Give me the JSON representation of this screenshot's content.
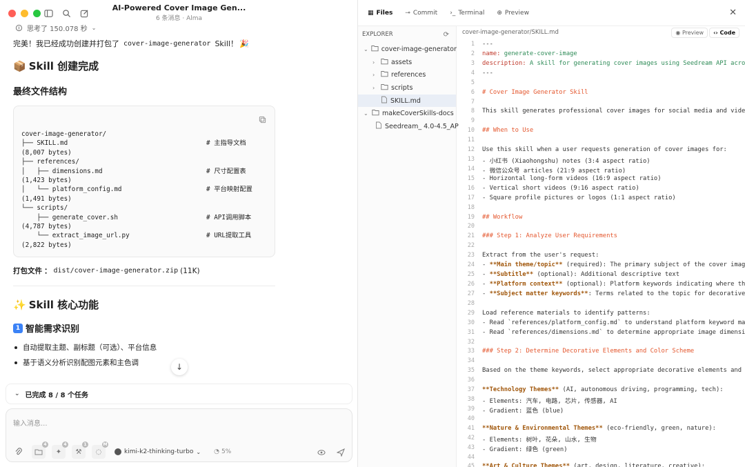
{
  "window": {
    "title": "AI-Powered Cover Image Gen...",
    "subtitle": "6 条消息 · Alma"
  },
  "chat": {
    "thought": "思考了 150.078 秒",
    "intro_prefix": "完美！我已经成功创建并打包了",
    "intro_code": "cover-image-generator",
    "intro_suffix": "Skill！",
    "h2_done": "Skill 创建完成",
    "h3_structure": "最终文件结构",
    "tree": [
      {
        "t": "cover-image-generator/",
        "c": ""
      },
      {
        "t": "├── SKILL.md",
        "c": "# 主指导文档"
      },
      {
        "t": "(8,007 bytes)",
        "c": ""
      },
      {
        "t": "├── references/",
        "c": ""
      },
      {
        "t": "│   ├── dimensions.md",
        "c": "# 尺寸配置表"
      },
      {
        "t": "(1,423 bytes)",
        "c": ""
      },
      {
        "t": "│   └── platform_config.md",
        "c": "# 平台映射配置"
      },
      {
        "t": "(1,491 bytes)",
        "c": ""
      },
      {
        "t": "└── scripts/",
        "c": ""
      },
      {
        "t": "    ├── generate_cover.sh",
        "c": "# API调用脚本"
      },
      {
        "t": "(4,787 bytes)",
        "c": ""
      },
      {
        "t": "    └── extract_image_url.py",
        "c": "# URL提取工具"
      },
      {
        "t": "(2,822 bytes)",
        "c": ""
      }
    ],
    "pack_label": "打包文件",
    "pack_path": "dist/cover-image-generator.zip",
    "pack_size": "(11K)",
    "h2_features": "Skill 核心功能",
    "h3_feature1": "智能需求识别",
    "bullets": [
      "自动提取主题、副标题（可选）、平台信息",
      "基于语义分析识别配图元素和主色调"
    ],
    "tasks": "已完成 8 / 8 个任务",
    "input_placeholder": "输入消息...",
    "model": "kimi-k2-thinking-turbo",
    "context_pct": "5%",
    "badges": [
      "4",
      "4",
      "1",
      "M"
    ]
  },
  "pane": {
    "tabs": [
      "Files",
      "Commit",
      "Terminal",
      "Preview"
    ],
    "explorer_title": "EXPLORER",
    "path": "cover-image-generator/SKILL.md",
    "preview_btn": "Preview",
    "code_btn": "Code",
    "files": [
      {
        "name": "cover-image-generator",
        "depth": 0,
        "kind": "folder-open"
      },
      {
        "name": "assets",
        "depth": 1,
        "kind": "folder"
      },
      {
        "name": "references",
        "depth": 1,
        "kind": "folder"
      },
      {
        "name": "scripts",
        "depth": 1,
        "kind": "folder"
      },
      {
        "name": "SKILL.md",
        "depth": 1,
        "kind": "file",
        "selected": true
      },
      {
        "name": "makeCoverSkills-docs",
        "depth": 0,
        "kind": "folder-open"
      },
      {
        "name": "Seedream_ 4.0-4.5_AP",
        "depth": 1,
        "kind": "file"
      }
    ],
    "lines": [
      {
        "n": "1",
        "s": [
          [
            "",
            "---"
          ]
        ]
      },
      {
        "n": "2",
        "s": [
          [
            "k",
            "name: "
          ],
          [
            "v",
            "generate-cover-image"
          ]
        ]
      },
      {
        "n": "3",
        "s": [
          [
            "k",
            "description: "
          ],
          [
            "v",
            "A skill for generating cover images using Seedream API acros"
          ]
        ]
      },
      {
        "n": "4",
        "s": [
          [
            "",
            "---"
          ]
        ]
      },
      {
        "n": "5",
        "s": [
          [
            "",
            ""
          ]
        ]
      },
      {
        "n": "6",
        "s": [
          [
            "hd",
            "# Cover Image Generator Skill"
          ]
        ]
      },
      {
        "n": "7",
        "s": [
          [
            "",
            ""
          ]
        ]
      },
      {
        "n": "8",
        "s": [
          [
            "",
            "This skill generates professional cover images for social media and video"
          ]
        ]
      },
      {
        "n": "9",
        "s": [
          [
            "",
            ""
          ]
        ]
      },
      {
        "n": "10",
        "s": [
          [
            "hd",
            "## When to Use"
          ]
        ]
      },
      {
        "n": "11",
        "s": [
          [
            "",
            ""
          ]
        ]
      },
      {
        "n": "12",
        "s": [
          [
            "",
            "Use this skill when a user requests generation of cover images for:"
          ]
        ]
      },
      {
        "n": "13",
        "s": [
          [
            "",
            "- 小红书 (Xiaohongshu) notes (3:4 aspect ratio)"
          ]
        ]
      },
      {
        "n": "14",
        "s": [
          [
            "",
            "- 微信公众号 articles (21:9 aspect ratio)"
          ]
        ]
      },
      {
        "n": "15",
        "s": [
          [
            "",
            "- Horizontal long-form videos (16:9 aspect ratio)"
          ]
        ]
      },
      {
        "n": "16",
        "s": [
          [
            "",
            "- Vertical short videos (9:16 aspect ratio)"
          ]
        ]
      },
      {
        "n": "17",
        "s": [
          [
            "",
            "- Square profile pictures or logos (1:1 aspect ratio)"
          ]
        ]
      },
      {
        "n": "18",
        "s": [
          [
            "",
            ""
          ]
        ]
      },
      {
        "n": "19",
        "s": [
          [
            "hd",
            "## Workflow"
          ]
        ]
      },
      {
        "n": "20",
        "s": [
          [
            "",
            ""
          ]
        ]
      },
      {
        "n": "21",
        "s": [
          [
            "hd",
            "### Step 1: Analyze User Requirements"
          ]
        ]
      },
      {
        "n": "22",
        "s": [
          [
            "",
            ""
          ]
        ]
      },
      {
        "n": "23",
        "s": [
          [
            "",
            "Extract from the user's request:"
          ]
        ]
      },
      {
        "n": "24",
        "s": [
          [
            "",
            "- "
          ],
          [
            "bold",
            "**Main theme/topic**"
          ],
          [
            "",
            " (required): The primary subject of the cover image"
          ]
        ]
      },
      {
        "n": "25",
        "s": [
          [
            "",
            "- "
          ],
          [
            "bold",
            "**Subtitle**"
          ],
          [
            "",
            " (optional): Additional descriptive text"
          ]
        ]
      },
      {
        "n": "26",
        "s": [
          [
            "",
            "- "
          ],
          [
            "bold",
            "**Platform context**"
          ],
          [
            "",
            " (optional): Platform keywords indicating where the"
          ]
        ]
      },
      {
        "n": "27",
        "s": [
          [
            "",
            "- "
          ],
          [
            "bold",
            "**Subject matter keywords**"
          ],
          [
            "",
            ": Terms related to the topic for decorative"
          ]
        ]
      },
      {
        "n": "28",
        "s": [
          [
            "",
            ""
          ]
        ]
      },
      {
        "n": "29",
        "s": [
          [
            "",
            "Load reference materials to identify patterns:"
          ]
        ]
      },
      {
        "n": "30",
        "s": [
          [
            "",
            "- Read `references/platform_config.md` to understand platform keyword map"
          ]
        ]
      },
      {
        "n": "31",
        "s": [
          [
            "",
            "- Read `references/dimensions.md` to determine appropriate image dimensio"
          ]
        ]
      },
      {
        "n": "32",
        "s": [
          [
            "",
            ""
          ]
        ]
      },
      {
        "n": "33",
        "s": [
          [
            "hd",
            "### Step 2: Determine Decorative Elements and Color Scheme"
          ]
        ]
      },
      {
        "n": "34",
        "s": [
          [
            "",
            ""
          ]
        ]
      },
      {
        "n": "35",
        "s": [
          [
            "",
            "Based on the theme keywords, select appropriate decorative elements and g"
          ]
        ]
      },
      {
        "n": "36",
        "s": [
          [
            "",
            ""
          ]
        ]
      },
      {
        "n": "37",
        "s": [
          [
            "bold",
            "**Technology Themes**"
          ],
          [
            "",
            " (AI, autonomous driving, programming, tech):"
          ]
        ]
      },
      {
        "n": "38",
        "s": [
          [
            "",
            "- Elements: 汽车, 电路, 芯片, 传感器, AI"
          ]
        ]
      },
      {
        "n": "39",
        "s": [
          [
            "",
            "- Gradient: 蓝色 (blue)"
          ]
        ]
      },
      {
        "n": "40",
        "s": [
          [
            "",
            ""
          ]
        ]
      },
      {
        "n": "41",
        "s": [
          [
            "bold",
            "**Nature & Environmental Themes**"
          ],
          [
            "",
            " (eco-friendly, green, nature):"
          ]
        ]
      },
      {
        "n": "42",
        "s": [
          [
            "",
            "- Elements: 树叶, 花朵, 山水, 生物"
          ]
        ]
      },
      {
        "n": "43",
        "s": [
          [
            "",
            "- Gradient: 绿色 (green)"
          ]
        ]
      },
      {
        "n": "44",
        "s": [
          [
            "",
            ""
          ]
        ]
      },
      {
        "n": "45",
        "s": [
          [
            "bold",
            "**Art & Culture Themes**"
          ],
          [
            "",
            " (art, design, literature, creative):"
          ]
        ]
      }
    ]
  }
}
